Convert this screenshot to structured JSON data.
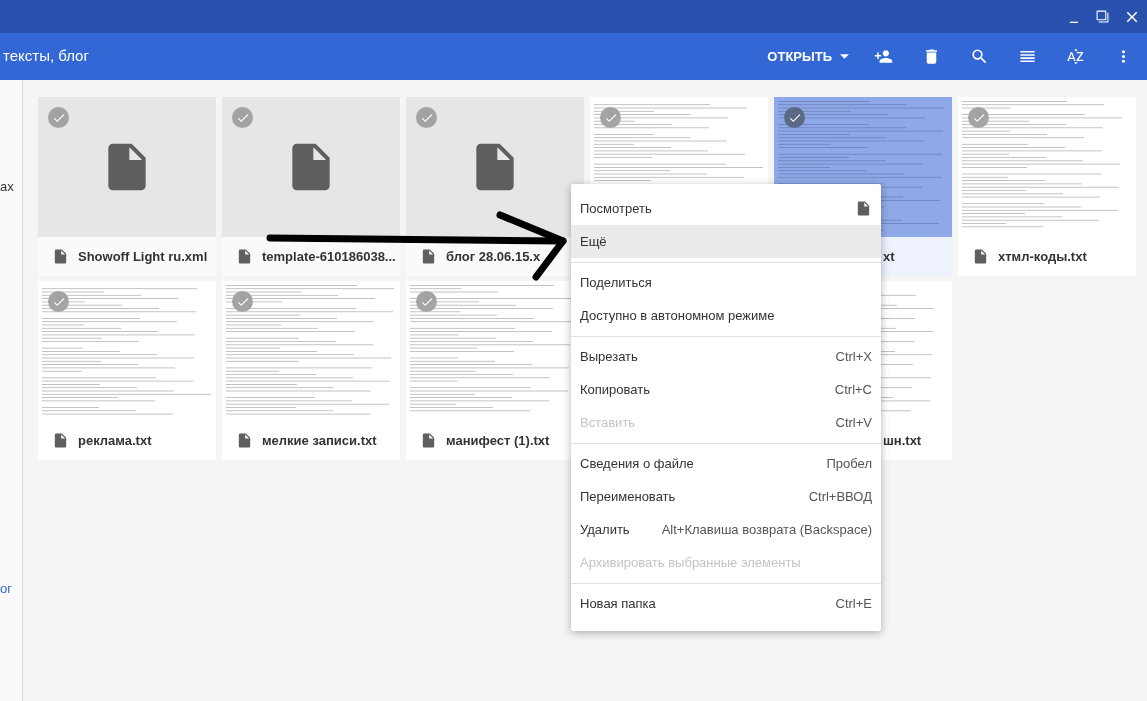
{
  "toolbar": {
    "title": "тексты, блог",
    "open_button": "ОТКРЫТЬ"
  },
  "sidebar": {
    "items": [
      {
        "label": "ах",
        "selected": false
      },
      {
        "label": "ог",
        "selected": true
      }
    ]
  },
  "files": [
    {
      "kind": "generic",
      "name": "Showoff Light ru.xml",
      "selected": false,
      "covered": false
    },
    {
      "kind": "generic",
      "name": "template-610186038...",
      "selected": false,
      "covered": false
    },
    {
      "kind": "generic",
      "name": "блог 28.06.15.x",
      "selected": false,
      "covered": false
    },
    {
      "kind": "text",
      "selected": false
    },
    {
      "kind": "text",
      "name": "xt",
      "selected": true,
      "covered": true
    },
    {
      "kind": "text",
      "name": "хтмл-коды.txt",
      "selected": false,
      "covered": false
    },
    {
      "kind": "text",
      "name": "реклама.txt",
      "selected": false,
      "covered": false
    },
    {
      "kind": "text",
      "name": "мелкие записи.txt",
      "selected": false,
      "covered": false
    },
    {
      "kind": "text",
      "name": "манифест (1).txt",
      "selected": false,
      "covered": false
    },
    {
      "kind": "text",
      "name": "шн.txt",
      "selected": false,
      "covered": true
    }
  ],
  "context_menu": {
    "groups": [
      [
        {
          "kind": "icon",
          "label": "Посмотреть",
          "selected": false,
          "disabled": false
        },
        {
          "kind": "plain",
          "label": "Ещё",
          "selected": true,
          "disabled": false
        }
      ],
      [
        {
          "kind": "plain",
          "label": "Поделиться",
          "selected": false,
          "disabled": false
        },
        {
          "kind": "plain",
          "label": "Доступно в автономном режиме",
          "selected": false,
          "disabled": false
        }
      ],
      [
        {
          "kind": "plain",
          "label": "Вырезать",
          "shortcut": "Ctrl+X",
          "selected": false,
          "disabled": false
        },
        {
          "kind": "plain",
          "label": "Копировать",
          "shortcut": "Ctrl+C",
          "selected": false,
          "disabled": false
        },
        {
          "kind": "plain",
          "label": "Вставить",
          "shortcut": "Ctrl+V",
          "selected": false,
          "disabled": true
        }
      ],
      [
        {
          "kind": "plain",
          "label": "Сведения о файле",
          "shortcut": "Пробел",
          "selected": false,
          "disabled": false
        },
        {
          "kind": "plain",
          "label": "Переименовать",
          "shortcut": "Ctrl+ВВОД",
          "selected": false,
          "disabled": false
        },
        {
          "kind": "plain",
          "label": "Удалить",
          "shortcut": "Alt+Клавиша возврата (Backspace)",
          "selected": false,
          "disabled": false
        },
        {
          "kind": "plain",
          "label": "Архивировать выбранные элементы",
          "selected": false,
          "disabled": true
        }
      ],
      [
        {
          "kind": "plain",
          "label": "Новая папка",
          "shortcut": "Ctrl+E",
          "selected": false,
          "disabled": false
        }
      ]
    ]
  }
}
